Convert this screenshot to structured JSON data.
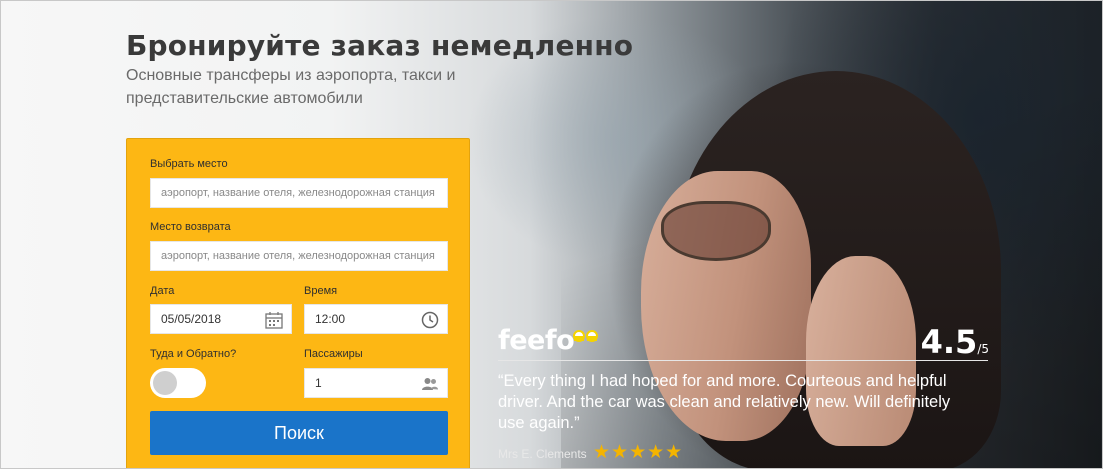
{
  "header": {
    "title": "Бронируйте заказ немедленно",
    "subtitle": "Основные трансферы из аэропорта, такси и представительские автомобили"
  },
  "form": {
    "pickup_label": "Выбрать место",
    "pickup_placeholder": "аэропорт, название отеля, железнодорожная станция",
    "dropoff_label": "Место возврата",
    "dropoff_placeholder": "аэропорт, название отеля, железнодорожная станция",
    "date_label": "Дата",
    "date_value": "05/05/2018",
    "time_label": "Время",
    "time_value": "12:00",
    "roundtrip_label": "Туда и Обратно?",
    "roundtrip_on": false,
    "passengers_label": "Пассажиры",
    "passengers_value": "1",
    "search_label": "Поиск"
  },
  "review": {
    "brand": "feefo",
    "rating": "4.5",
    "rating_max": "/5",
    "quote": "“Every thing I had hoped for and more. Courteous and helpful driver. And the car was clean and relatively new. Will definitely use again.”",
    "author": "Mrs E. Clements",
    "stars": "★★★★★"
  },
  "colors": {
    "form_bg": "#fdb714",
    "button_bg": "#1a74c9",
    "star": "#f4b400"
  }
}
